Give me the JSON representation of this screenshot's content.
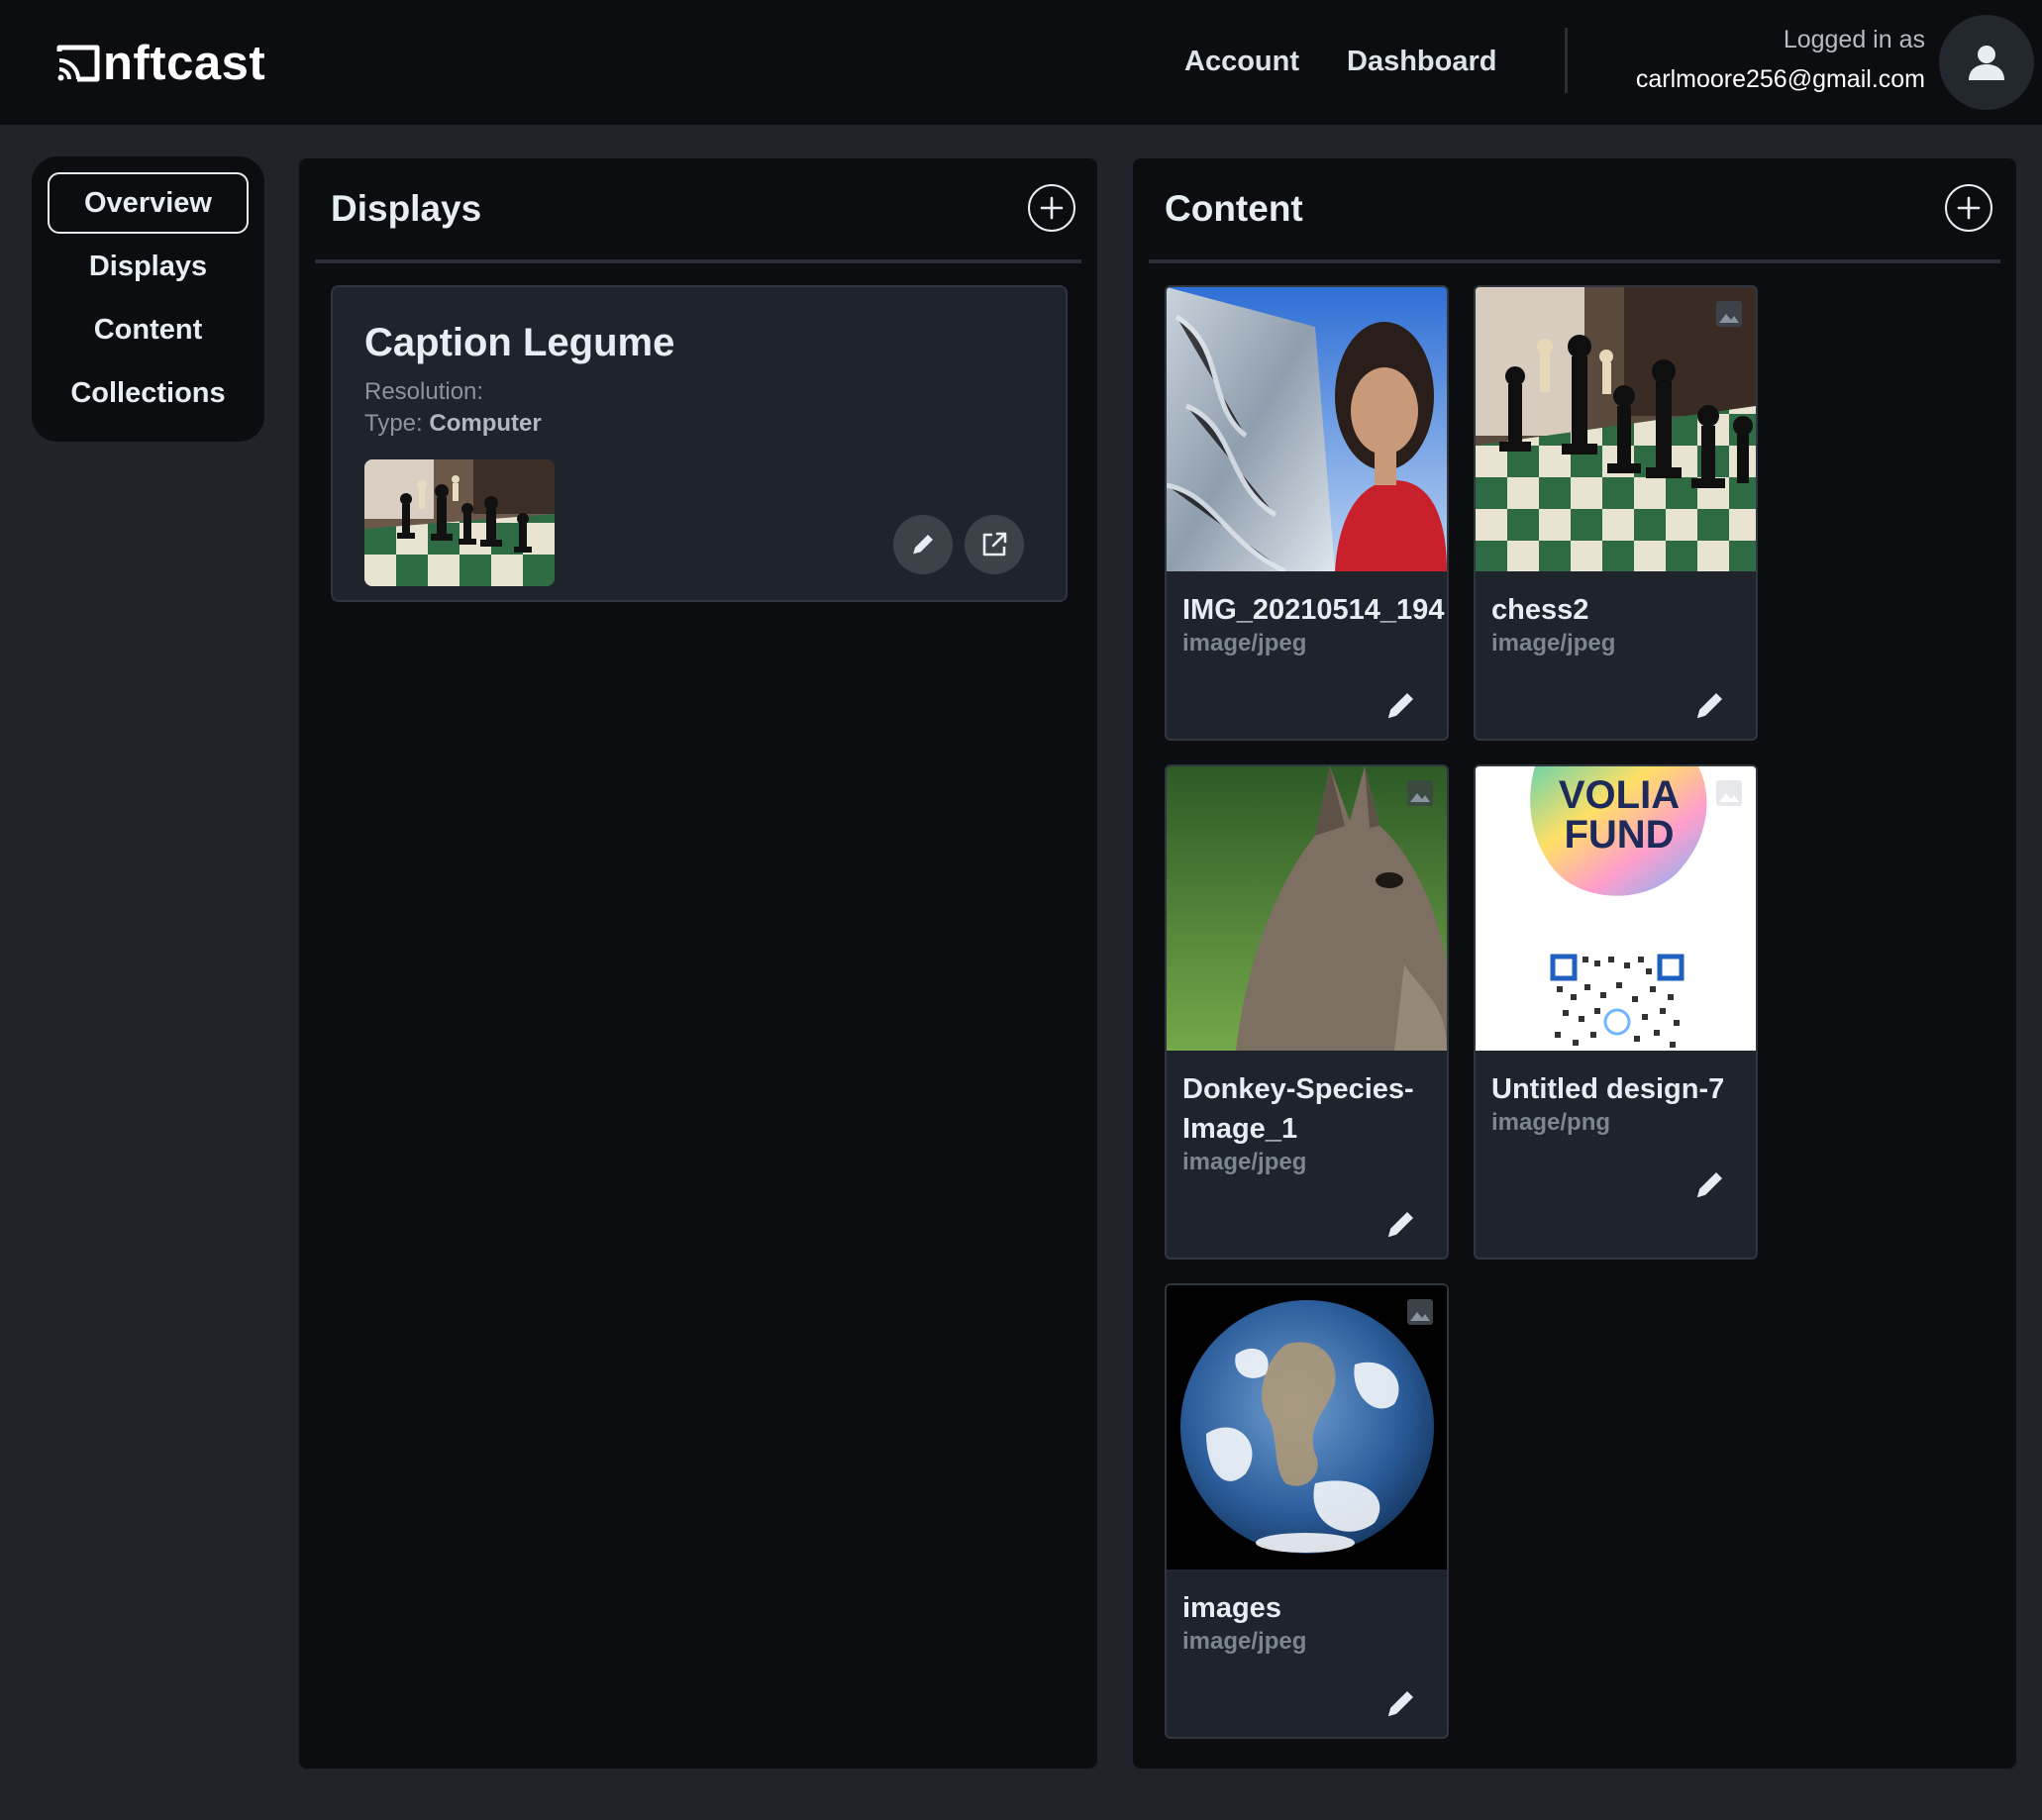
{
  "brand": {
    "name": "nftcast"
  },
  "nav": {
    "account": "Account",
    "dashboard": "Dashboard",
    "logged_in_label": "Logged in as",
    "email": "carlmoore256@gmail.com"
  },
  "sidebar": {
    "items": [
      {
        "label": "Overview",
        "active": true
      },
      {
        "label": "Displays"
      },
      {
        "label": "Content"
      },
      {
        "label": "Collections"
      }
    ]
  },
  "displays": {
    "title": "Displays",
    "cards": [
      {
        "name": "Caption Legume",
        "resolution_label": "Resolution:",
        "resolution_value": "",
        "type_label": "Type:",
        "type_value": "Computer"
      }
    ]
  },
  "content": {
    "title": "Content",
    "items": [
      {
        "name": "IMG_20210514_194",
        "type": "image/jpeg",
        "thumbnail": "woman-photo"
      },
      {
        "name": "chess2",
        "type": "image/jpeg",
        "thumbnail": "chess-photo"
      },
      {
        "name": "Donkey-Species-Image_1",
        "type": "image/jpeg",
        "thumbnail": "donkey-photo"
      },
      {
        "name": "Untitled design-7",
        "type": "image/png",
        "thumbnail": "volia-fund-qr",
        "thumb_text_line1": "VOLIA",
        "thumb_text_line2": "FUND"
      },
      {
        "name": "images",
        "type": "image/jpeg",
        "thumbnail": "earth-photo"
      }
    ]
  },
  "colors": {
    "page_bg": "#20232a",
    "topbar_bg": "#0c0d10",
    "panel_bg": "#0c0d10",
    "card_bg": "#1f232b",
    "card_border": "#30363d",
    "text_primary": "#e6edf3",
    "text_muted": "#8b949e"
  }
}
